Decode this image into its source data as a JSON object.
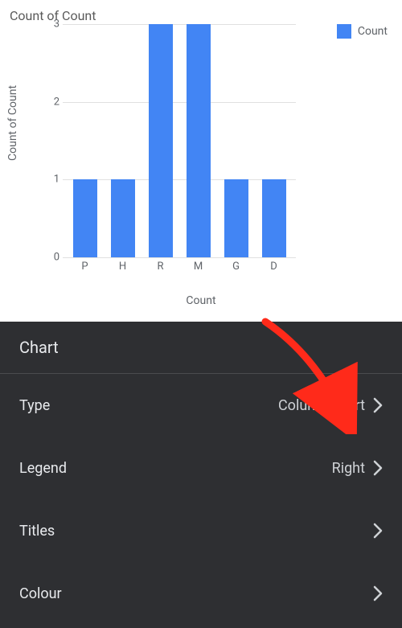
{
  "chart_data": {
    "type": "bar",
    "title": "Count of Count",
    "xlabel": "Count",
    "ylabel": "Count of Count",
    "ylim": [
      0,
      3
    ],
    "yticks": [
      0,
      1,
      2,
      3
    ],
    "categories": [
      "P",
      "H",
      "R",
      "M",
      "G",
      "D"
    ],
    "values": [
      1,
      1,
      3,
      3,
      1,
      1
    ],
    "legend": "Count",
    "legend_position": "right",
    "bar_color": "#4285f4"
  },
  "panel": {
    "header": "Chart",
    "rows": {
      "type": {
        "label": "Type",
        "value": "Column chart"
      },
      "legend": {
        "label": "Legend",
        "value": "Right"
      },
      "titles": {
        "label": "Titles",
        "value": ""
      },
      "colour": {
        "label": "Colour",
        "value": ""
      }
    }
  }
}
